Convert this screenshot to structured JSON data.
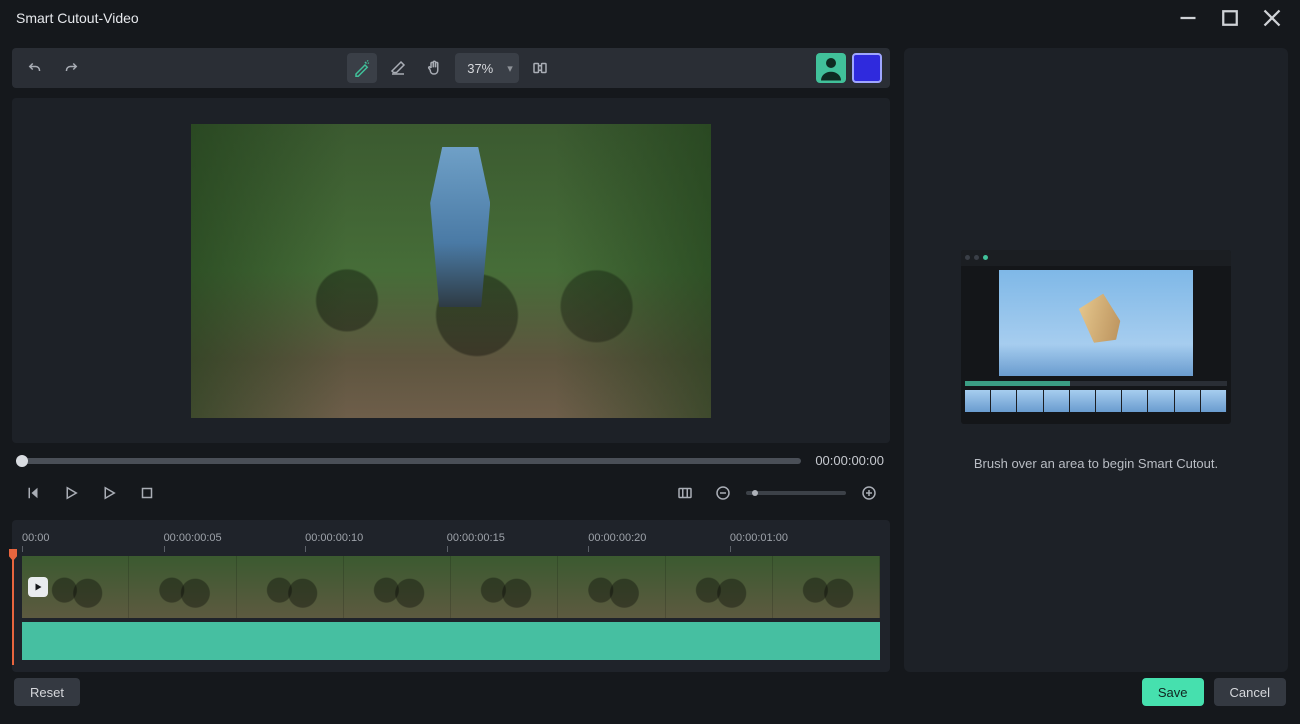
{
  "titlebar": {
    "title": "Smart Cutout-Video"
  },
  "toolbar": {
    "zoom": "37%",
    "icons": {
      "undo": "undo-icon",
      "redo": "redo-icon",
      "brush": "magic-brush-icon",
      "eraser": "eraser-icon",
      "pan": "hand-icon",
      "compare": "compare-icon"
    }
  },
  "scrubber": {
    "time": "00:00:00:00"
  },
  "timeline": {
    "marks": [
      "00:00",
      "00:00:00:05",
      "00:00:00:10",
      "00:00:00:15",
      "00:00:00:20",
      "00:00:01:00"
    ],
    "mark_positions_pct": [
      0,
      16.5,
      33,
      49.5,
      66,
      82.5
    ]
  },
  "hint": {
    "text": "Brush over an area to begin Smart Cutout."
  },
  "footer": {
    "reset": "Reset",
    "save": "Save",
    "cancel": "Cancel"
  },
  "colors": {
    "accent": "#46e0ae",
    "swatch": "#2f2add"
  }
}
